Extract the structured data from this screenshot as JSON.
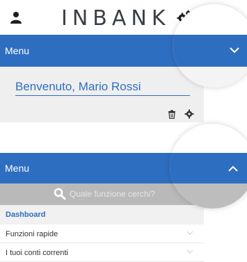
{
  "header": {
    "logo_text": "INBANK",
    "user_icon": "user-icon",
    "settings_icon": "gears-icon"
  },
  "panel_collapsed": {
    "menu_label": "Menu",
    "toggle_icon": "chevron-down-icon",
    "welcome_text": "Benvenuto, Mario Rossi",
    "actions": [
      "trash-icon",
      "gear-icon"
    ]
  },
  "panel_expanded": {
    "menu_label": "Menu",
    "toggle_icon": "chevron-up-icon",
    "search": {
      "placeholder": "Quale funzione cerchi?",
      "value": ""
    },
    "nav_items": [
      {
        "label": "Dashboard",
        "active": true
      },
      {
        "label": "Funzioni rapide"
      },
      {
        "label": "I tuoi conti correnti"
      }
    ]
  },
  "colors": {
    "brand_blue": "#2e6ec1",
    "panel_grey": "#efefef",
    "search_grey": "#b9b9b9"
  }
}
